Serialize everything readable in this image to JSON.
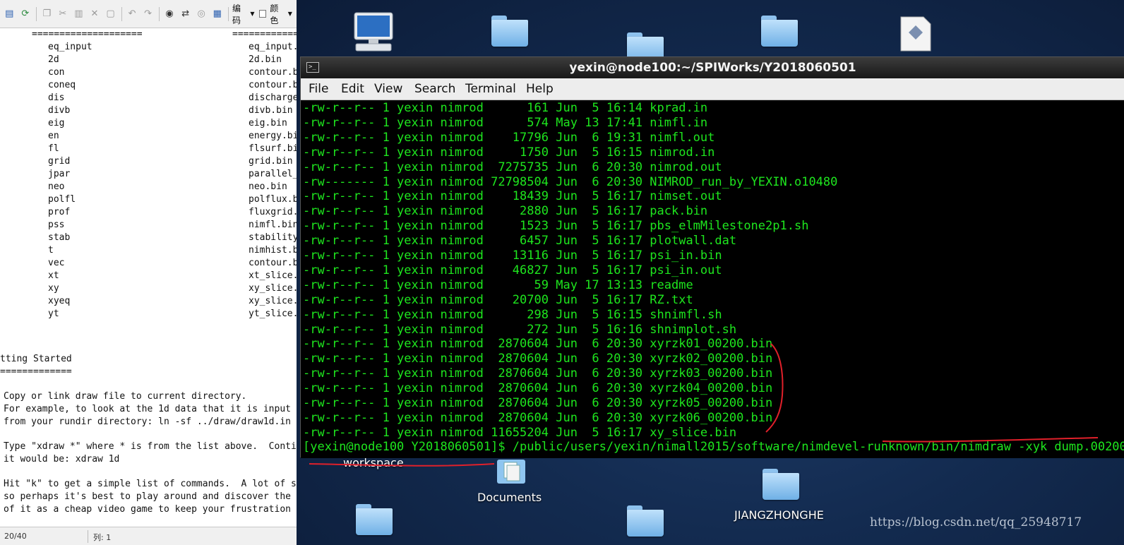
{
  "editor": {
    "toolbar": {
      "encoding_label": "编码",
      "color_label": "颜色"
    },
    "top_divider_left": "====================",
    "top_divider_right": "============",
    "list": [
      {
        "name": "eq_input",
        "file": "eq_input."
      },
      {
        "name": "2d",
        "file": "2d.bin"
      },
      {
        "name": "con",
        "file": "contour.b"
      },
      {
        "name": "coneq",
        "file": "contour.b"
      },
      {
        "name": "dis",
        "file": "discharge"
      },
      {
        "name": "divb",
        "file": "divb.bin"
      },
      {
        "name": "eig",
        "file": "eig.bin"
      },
      {
        "name": "en",
        "file": "energy.bi"
      },
      {
        "name": "fl",
        "file": "flsurf.bi"
      },
      {
        "name": "grid",
        "file": "grid.bin"
      },
      {
        "name": "jpar",
        "file": "parallel_"
      },
      {
        "name": "neo",
        "file": "neo.bin"
      },
      {
        "name": "polfl",
        "file": "polflux.b"
      },
      {
        "name": "prof",
        "file": "fluxgrid."
      },
      {
        "name": "pss",
        "file": "nimfl.bin"
      },
      {
        "name": "stab",
        "file": "stability"
      },
      {
        "name": "t",
        "file": "nimhist.b"
      },
      {
        "name": "vec",
        "file": "contour.b"
      },
      {
        "name": "xt",
        "file": "xt_slice."
      },
      {
        "name": "xy",
        "file": "xy_slice."
      },
      {
        "name": "xyeq",
        "file": "xy_slice."
      },
      {
        "name": "yt",
        "file": "yt_slice."
      }
    ],
    "section_title": "tting Started",
    "section_underline": "=============",
    "paragraphs": [
      "Copy or link draw file to current directory.",
      "For example, to look at the 1d data that it is input",
      "from your rundir directory: ln -sf ../draw/draw1d.in",
      "Type \"xdraw *\" where * is from the list above.  Conti",
      "it would be: xdraw 1d",
      "Hit \"k\" to get a simple list of commands.  A lot of s",
      "so perhaps it's best to play around and discover the",
      "of it as a cheap video game to keep your frustration"
    ],
    "status": {
      "position": "20/40",
      "column": "列: 1"
    }
  },
  "desktop": {
    "labels": {
      "workspace": "workspace",
      "documents": "Documents",
      "jiangzhonghe": "JIANGZHONGHE"
    },
    "watermark": "https://blog.csdn.net/qq_25948717"
  },
  "terminal": {
    "title": "yexin@node100:~/SPIWorks/Y2018060501",
    "menu": [
      "File",
      "Edit",
      "View",
      "Search",
      "Terminal",
      "Help"
    ],
    "lines": [
      "-rw-r--r-- 1 yexin nimrod      161 Jun  5 16:14 kprad.in",
      "-rw-r--r-- 1 yexin nimrod      574 May 13 17:41 nimfl.in",
      "-rw-r--r-- 1 yexin nimrod    17796 Jun  6 19:31 nimfl.out",
      "-rw-r--r-- 1 yexin nimrod     1750 Jun  5 16:15 nimrod.in",
      "-rw-r--r-- 1 yexin nimrod  7275735 Jun  6 20:30 nimrod.out",
      "-rw------- 1 yexin nimrod 72798504 Jun  6 20:30 NIMROD_run_by_YEXIN.o10480",
      "-rw-r--r-- 1 yexin nimrod    18439 Jun  5 16:17 nimset.out",
      "-rw-r--r-- 1 yexin nimrod     2880 Jun  5 16:17 pack.bin",
      "-rw-r--r-- 1 yexin nimrod     1523 Jun  5 16:17 pbs_elmMilestone2p1.sh",
      "-rw-r--r-- 1 yexin nimrod     6457 Jun  5 16:17 plotwall.dat",
      "-rw-r--r-- 1 yexin nimrod    13116 Jun  5 16:17 psi_in.bin",
      "-rw-r--r-- 1 yexin nimrod    46827 Jun  5 16:17 psi_in.out",
      "-rw-r--r-- 1 yexin nimrod       59 May 17 13:13 readme",
      "-rw-r--r-- 1 yexin nimrod    20700 Jun  5 16:17 RZ.txt",
      "-rw-r--r-- 1 yexin nimrod      298 Jun  5 16:15 shnimfl.sh",
      "-rw-r--r-- 1 yexin nimrod      272 Jun  5 16:16 shnimplot.sh",
      "-rw-r--r-- 1 yexin nimrod  2870604 Jun  6 20:30 xyrzk01_00200.bin",
      "-rw-r--r-- 1 yexin nimrod  2870604 Jun  6 20:30 xyrzk02_00200.bin",
      "-rw-r--r-- 1 yexin nimrod  2870604 Jun  6 20:30 xyrzk03_00200.bin",
      "-rw-r--r-- 1 yexin nimrod  2870604 Jun  6 20:30 xyrzk04_00200.bin",
      "-rw-r--r-- 1 yexin nimrod  2870604 Jun  6 20:30 xyrzk05_00200.bin",
      "-rw-r--r-- 1 yexin nimrod  2870604 Jun  6 20:30 xyrzk06_00200.bin",
      "-rw-r--r-- 1 yexin nimrod 11655204 Jun  5 16:17 xy_slice.bin"
    ],
    "prompt": "[yexin@node100 Y2018060501]$ /public/users/yexin/nimall2015/software/nimdevel-runknown/bin/nimdraw -xyk dump.00200"
  },
  "colors": {
    "terminal_text": "#1ee61e",
    "terminal_bg": "#000000",
    "annotation": "#e0202a",
    "desktop_bg": "#132b50"
  }
}
